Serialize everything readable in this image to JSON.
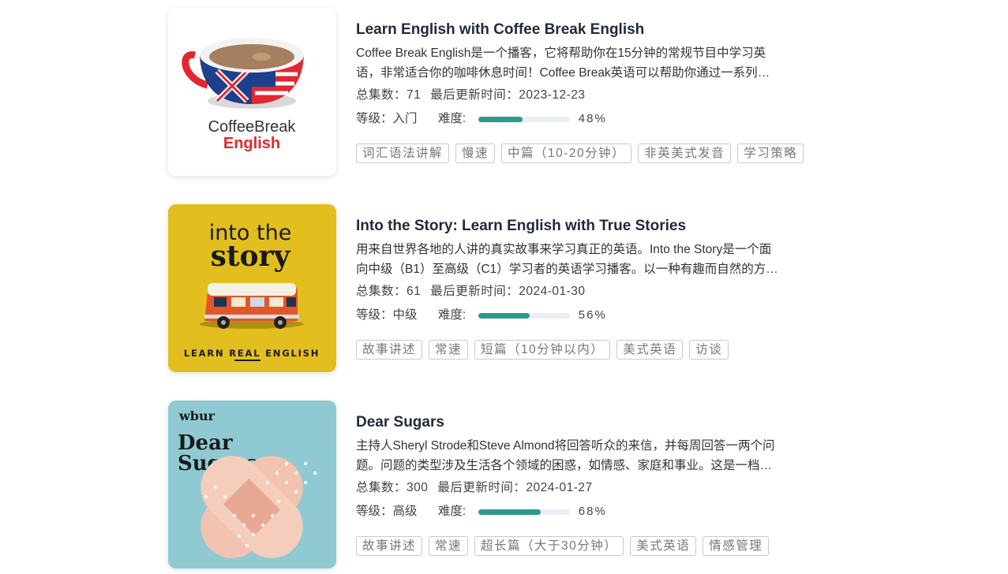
{
  "podcasts": [
    {
      "title": "Learn English with Coffee Break English",
      "description": "Coffee Break English是一个播客，它将帮助你在15分钟的常规节目中学习英语，非常适合你的咖啡休息时间！Coffee Break英语可以帮助你通过一系列课程来提高英语水平。",
      "episodes_label": "总集数：71",
      "updated_label": "最后更新时间：2023-12-23",
      "level_label": "等级：入门",
      "difficulty_label": "难度:",
      "difficulty_percent": 48,
      "difficulty_text": "48%",
      "tags": [
        "词汇语法讲解",
        "慢速",
        "中篇（10-20分钟）",
        "非英美式发音",
        "学习策略"
      ],
      "cover": {
        "line1": "CoffeeBreak",
        "line2": "English"
      }
    },
    {
      "title": "Into the Story: Learn English with True Stories",
      "description": "用来自世界各地的人讲的真实故事来学习真正的英语。Into the Story是一个面向中级（B1）至高级（C1）学习者的英语学习播客。以一种有趣而自然的方式学习英语。",
      "episodes_label": "总集数：61",
      "updated_label": "最后更新时间：2024-01-30",
      "level_label": "等级：中级",
      "difficulty_label": "难度:",
      "difficulty_percent": 56,
      "difficulty_text": "56%",
      "tags": [
        "故事讲述",
        "常速",
        "短篇（10分钟以内）",
        "美式英语",
        "访谈"
      ],
      "cover": {
        "line1": "into the",
        "line2": "story",
        "line3": "LEARN REAL ENGLISH"
      }
    },
    {
      "title": "Dear Sugars",
      "description": "主持人Sheryl Strode和Steve Almond将回答听众的来信，并每周回答一两个问题。问题的类型涉及生活各个领域的困惑，如情感、家庭和事业。这是一档充满温情的节目。",
      "episodes_label": "总集数：300",
      "updated_label": "最后更新时间：2024-01-27",
      "level_label": "等级：高级",
      "difficulty_label": "难度:",
      "difficulty_percent": 68,
      "difficulty_text": "68%",
      "tags": [
        "故事讲述",
        "常速",
        "超长篇（大于30分钟）",
        "美式英语",
        "情感管理"
      ],
      "cover": {
        "brand": "wbur",
        "line1": "Dear",
        "line2": "Sugars"
      }
    }
  ],
  "colors": {
    "accent": "#2e9a8e",
    "title": "#1f2a3a",
    "cover2_bg": "#e2bf1f",
    "cover3_bg": "#8fcad2"
  }
}
